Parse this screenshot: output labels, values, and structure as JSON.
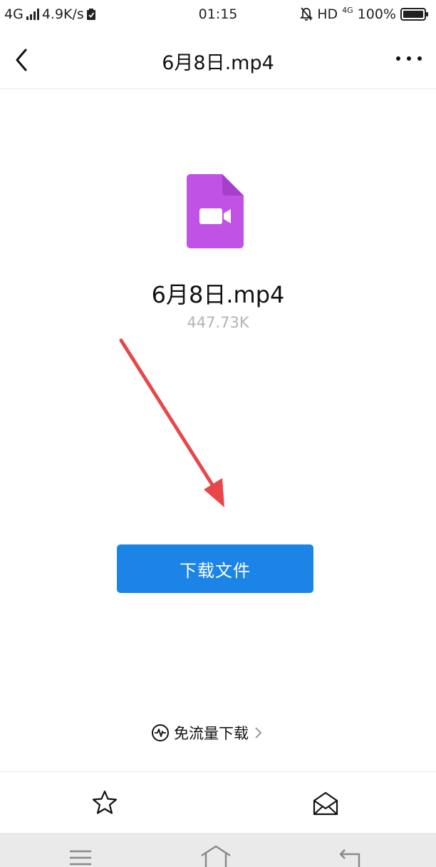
{
  "status_bar": {
    "network": "4G",
    "speed": "4.9K/s",
    "time": "01:15",
    "hd": "HD",
    "network_right": "4G",
    "battery": "100%"
  },
  "header": {
    "title": "6月8日.mp4",
    "back_icon": "chevron-left-icon",
    "more_icon": "more-horizontal-icon"
  },
  "file": {
    "icon": "video-file-icon",
    "icon_color": "#c152e6",
    "name": "6月8日.mp4",
    "size": "447.73K"
  },
  "annotation": {
    "arrow_color": "#e8474a"
  },
  "actions": {
    "download_label": "下载文件",
    "download_color": "#1b84e6",
    "free_download_label": "免流量下载"
  },
  "bottom_bar": {
    "star_icon": "star-outline-icon",
    "mail_icon": "envelope-open-icon"
  }
}
